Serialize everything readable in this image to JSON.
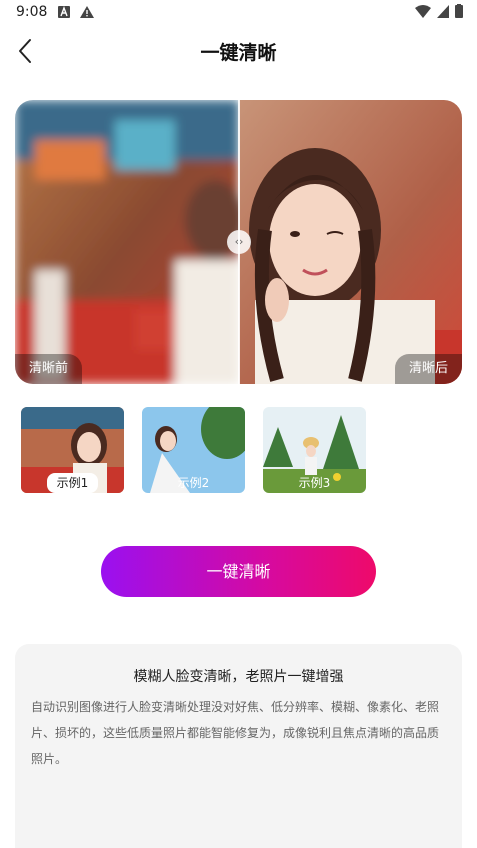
{
  "status_bar": {
    "time": "9:08"
  },
  "header": {
    "title": "一键清晰",
    "back_icon": "chevron-left-icon"
  },
  "compare": {
    "before_label": "清晰前",
    "after_label": "清晰后",
    "handle_glyph": "‹›"
  },
  "samples": [
    {
      "label": "示例1",
      "selected": true
    },
    {
      "label": "示例2",
      "selected": false
    },
    {
      "label": "示例3",
      "selected": false
    }
  ],
  "action": {
    "label": "一键清晰"
  },
  "description": {
    "title": "模糊人脸变清晰，老照片一键增强",
    "body": "自动识别图像进行人脸变清晰处理没对好焦、低分辨率、模糊、像素化、老照片、损坏的，这些低质量照片都能智能修复为，成像锐利且焦点清晰的高品质照片。"
  },
  "colors": {
    "accent_start": "#9a10f0",
    "accent_end": "#ee0a6a"
  }
}
